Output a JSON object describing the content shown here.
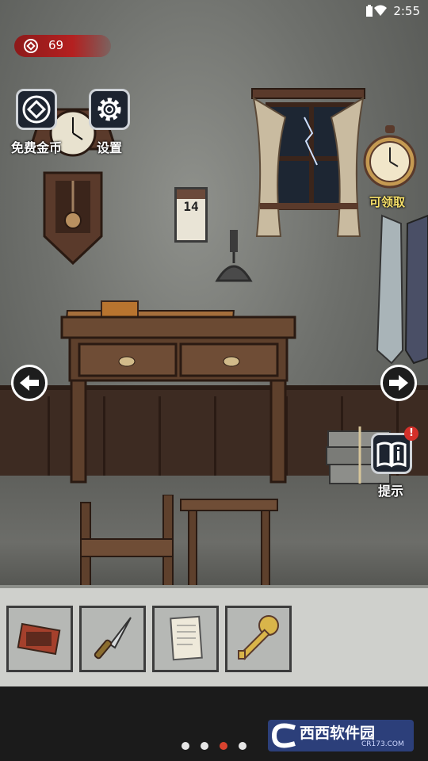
{
  "status_bar": {
    "time": "2:55"
  },
  "coins": {
    "count": "69"
  },
  "free_coins": {
    "label": "免费金币"
  },
  "settings": {
    "label": "设置"
  },
  "reward_clock": {
    "label": "可领取"
  },
  "hint": {
    "label": "提示",
    "badge": "!"
  },
  "scene": {
    "calendar_day": "14"
  },
  "inventory": {
    "items": [
      "matchbox-icon",
      "knife-icon",
      "note-paper-icon",
      "brass-key-icon"
    ]
  },
  "page_dots": {
    "count": 4,
    "active_index": 2,
    "active_color": "#d9432f"
  },
  "watermark": {
    "text": "西西软件园",
    "url_text": "CR173.COM"
  },
  "colors": {
    "coin_bar": "#b42020",
    "button_bg": "#1d2430",
    "inventory_bg": "#cfd0cc"
  }
}
